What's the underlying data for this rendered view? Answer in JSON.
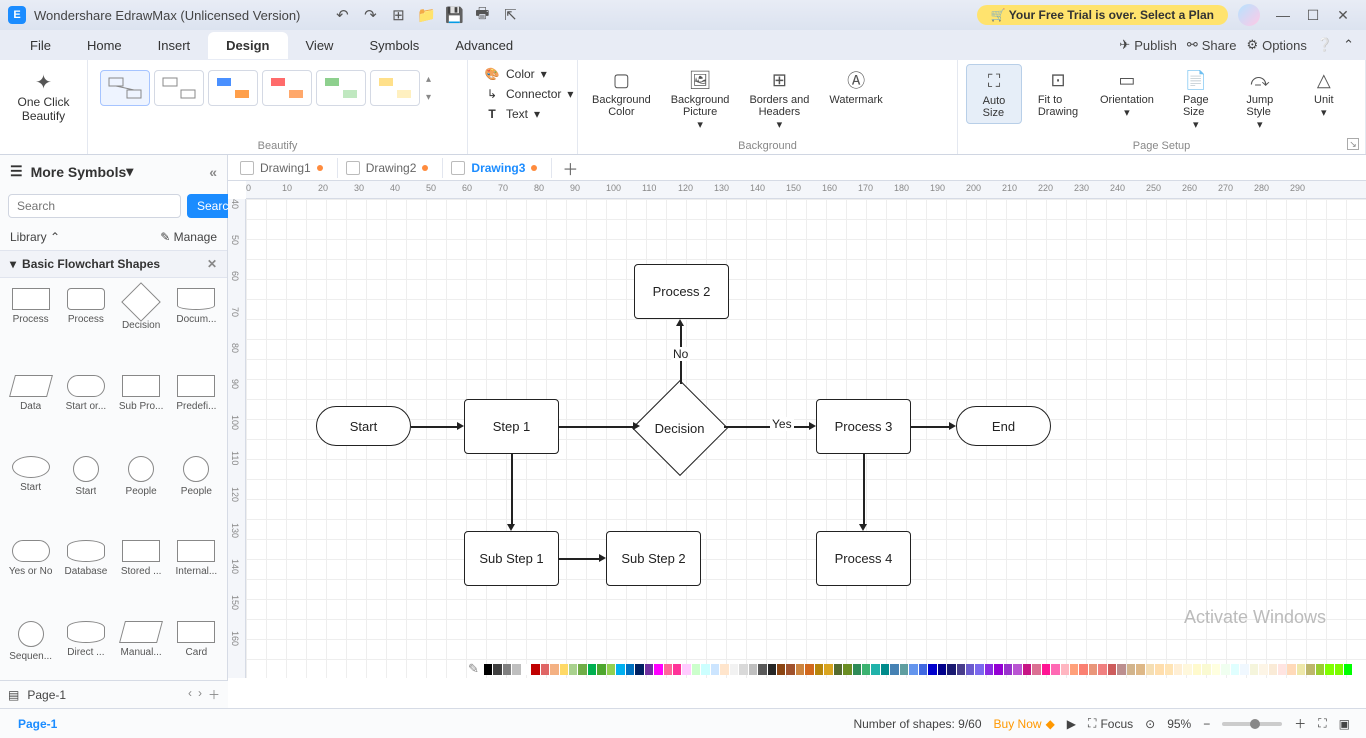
{
  "title": "Wondershare EdrawMax (Unlicensed Version)",
  "trial": "Your Free Trial is over. Select a Plan",
  "menu": {
    "file": "File",
    "home": "Home",
    "insert": "Insert",
    "design": "Design",
    "view": "View",
    "symbols": "Symbols",
    "advanced": "Advanced",
    "publish": "Publish",
    "share": "Share",
    "options": "Options"
  },
  "ribbon": {
    "beautify": {
      "label": "One Click\nBeautify",
      "group": "Beautify"
    },
    "color": "Color",
    "connector": "Connector",
    "text": "Text",
    "bgcolor": "Background\nColor",
    "bgpic": "Background\nPicture",
    "borders": "Borders and\nHeaders",
    "watermark": "Watermark",
    "bg_group": "Background",
    "autosize": "Auto\nSize",
    "fitdraw": "Fit to\nDrawing",
    "orient": "Orientation",
    "pagesize": "Page\nSize",
    "jump": "Jump\nStyle",
    "unit": "Unit",
    "ps_group": "Page Setup"
  },
  "sidebar": {
    "more": "More Symbols",
    "search_ph": "Search",
    "search_btn": "Search",
    "library": "Library",
    "manage": "Manage",
    "panel": "Basic Flowchart Shapes",
    "shapes": [
      {
        "n": "Process",
        "c": "rect"
      },
      {
        "n": "Process",
        "c": "round"
      },
      {
        "n": "Decision",
        "c": "diam"
      },
      {
        "n": "Docum...",
        "c": "doc"
      },
      {
        "n": "Data",
        "c": "par"
      },
      {
        "n": "Start or...",
        "c": "pill"
      },
      {
        "n": "Sub Pro...",
        "c": "rect"
      },
      {
        "n": "Predefi...",
        "c": "rect"
      },
      {
        "n": "Start",
        "c": "ellipse"
      },
      {
        "n": "Start",
        "c": "circle"
      },
      {
        "n": "People",
        "c": "circle"
      },
      {
        "n": "People",
        "c": "circle"
      },
      {
        "n": "Yes or No",
        "c": "pill"
      },
      {
        "n": "Database",
        "c": "cyl"
      },
      {
        "n": "Stored ...",
        "c": "rect"
      },
      {
        "n": "Internal...",
        "c": "rect"
      },
      {
        "n": "Sequen...",
        "c": "circle"
      },
      {
        "n": "Direct ...",
        "c": "cyl"
      },
      {
        "n": "Manual...",
        "c": "par"
      },
      {
        "n": "Card",
        "c": "rect"
      }
    ]
  },
  "tabs": [
    {
      "name": "Drawing1",
      "active": false,
      "dot": "orange"
    },
    {
      "name": "Drawing2",
      "active": false,
      "dot": "orange"
    },
    {
      "name": "Drawing3",
      "active": true,
      "dot": "orange"
    }
  ],
  "ruler_h": [
    0,
    10,
    20,
    30,
    40,
    50,
    60,
    70,
    80,
    90,
    100,
    110,
    120,
    130,
    140,
    150,
    160,
    170,
    180,
    190,
    200,
    210,
    220,
    230,
    240,
    250,
    260,
    270,
    280,
    290
  ],
  "ruler_v": [
    40,
    50,
    60,
    70,
    80,
    90,
    100,
    110,
    120,
    130,
    140,
    150,
    160
  ],
  "flow": {
    "start": "Start",
    "step1": "Step 1",
    "decision": "Decision",
    "process2": "Process 2",
    "process3": "Process 3",
    "end": "End",
    "substep1": "Sub Step 1",
    "substep2": "Sub Step 2",
    "process4": "Process 4",
    "yes": "Yes",
    "no": "No"
  },
  "status": {
    "page": "Page-1",
    "pagetab": "Page-1",
    "shapes": "Number of shapes: 9/60",
    "buy": "Buy Now",
    "focus": "Focus",
    "zoom": "95%"
  },
  "watermark": "Activate Windows",
  "colors": [
    "#000",
    "#404040",
    "#808080",
    "#bfbfbf",
    "#fff",
    "#c00000",
    "#e06666",
    "#f4b183",
    "#ffd966",
    "#a9d18e",
    "#70ad47",
    "#00b050",
    "#4ea72e",
    "#92d050",
    "#00b0f0",
    "#0070c0",
    "#002060",
    "#7030a0",
    "#ff00ff",
    "#ff6699",
    "#ff3399",
    "#ffccff",
    "#ccffcc",
    "#ccffff",
    "#cce5ff",
    "#ffe5cc",
    "#f2f2f2",
    "#d9d9d9",
    "#bfbfbf",
    "#595959",
    "#262626",
    "#8b4513",
    "#a0522d",
    "#cd853f",
    "#d2691e",
    "#b8860b",
    "#daa520",
    "#556b2f",
    "#6b8e23",
    "#2e8b57",
    "#3cb371",
    "#20b2aa",
    "#008b8b",
    "#4682b4",
    "#5f9ea0",
    "#6495ed",
    "#4169e1",
    "#0000cd",
    "#00008b",
    "#191970",
    "#483d8b",
    "#6a5acd",
    "#7b68ee",
    "#8a2be2",
    "#9400d3",
    "#9932cc",
    "#ba55d3",
    "#c71585",
    "#db7093",
    "#ff1493",
    "#ff69b4",
    "#ffb6c1",
    "#ffa07a",
    "#fa8072",
    "#e9967a",
    "#f08080",
    "#cd5c5c",
    "#bc8f8f",
    "#d2b48c",
    "#deb887",
    "#f5deb3",
    "#ffdead",
    "#ffe4b5",
    "#ffefd5",
    "#fff8dc",
    "#fffacd",
    "#fafad2",
    "#ffffe0",
    "#f0fff0",
    "#e0ffff",
    "#f0f8ff",
    "#f5f5dc",
    "#fdf5e6",
    "#faebd7",
    "#ffe4e1",
    "#ffdab9",
    "#eee8aa",
    "#bdb76b",
    "#9acd32",
    "#7fff00",
    "#7cfc00",
    "#00ff00"
  ]
}
